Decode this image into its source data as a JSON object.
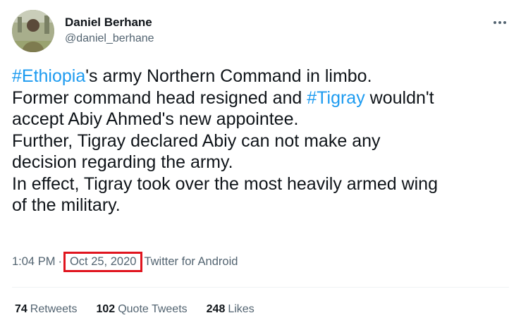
{
  "author": {
    "display_name": "Daniel Berhane",
    "handle": "@daniel_berhane"
  },
  "more_icon": "more-horizontal-icon",
  "tweet": {
    "line1_hashtag": "#Ethiopia",
    "line1_text": "'s army Northern Command in limbo.",
    "line2_text": "Former command head resigned and ",
    "line2_hashtag": "#Tigray",
    "line2_text_after": " wouldn't",
    "line3_text": "accept Abiy Ahmed's new appointee.",
    "line4_text": "Further, Tigray declared Abiy can not make any",
    "line5_text": "decision regarding the army.",
    "line6_text": "In effect, Tigray took over the most heavily armed wing",
    "line7_text": "of the military."
  },
  "meta": {
    "time": "1:04 PM",
    "separator": "·",
    "date": "Oct 25, 2020",
    "source": "Twitter for Android"
  },
  "stats": {
    "retweets_count": "74",
    "retweets_label": "Retweets",
    "quotes_count": "102",
    "quotes_label": "Quote Tweets",
    "likes_count": "248",
    "likes_label": "Likes"
  },
  "colors": {
    "hashtag": "#1d9bf0",
    "secondary_text": "#536471",
    "highlight_box": "#e0141e"
  }
}
